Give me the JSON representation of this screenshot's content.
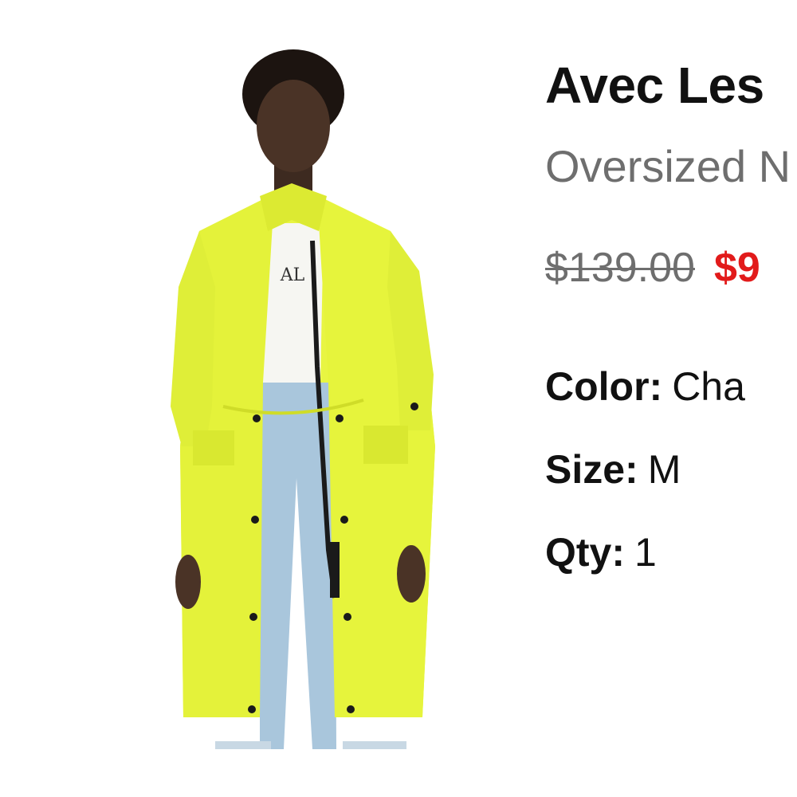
{
  "product": {
    "image_alt": "Model wearing an oversized neon yellow parka over a white logo tee and light blue jeans",
    "brand": "Avec Les",
    "name": "Oversized N",
    "price": {
      "original": "$139.00",
      "sale": "$9"
    },
    "attributes": {
      "color_label": "Color:",
      "color_value": "Cha",
      "size_label": "Size:",
      "size_value": "M",
      "qty_label": "Qty:",
      "qty_value": "1"
    }
  },
  "colors": {
    "sale_price": "#e21b1b",
    "secondary_text": "#6e6e6e",
    "coat": "#e8f542"
  }
}
